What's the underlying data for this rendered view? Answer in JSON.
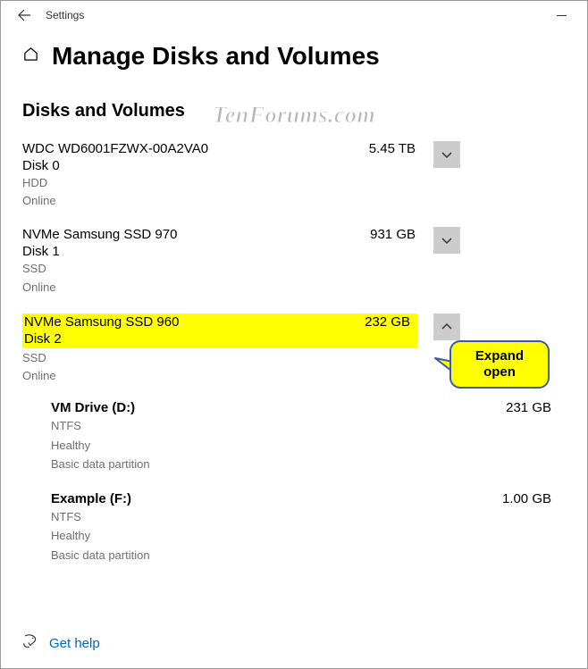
{
  "window": {
    "title": "Settings"
  },
  "page": {
    "title": "Manage Disks and Volumes",
    "section": "Disks and Volumes"
  },
  "disks": [
    {
      "name": "WDC WD6001FZWX-00A2VA0",
      "size": "5.45 TB",
      "label": "Disk 0",
      "type": "HDD",
      "status": "Online",
      "expanded": false
    },
    {
      "name": "NVMe Samsung SSD 970",
      "size": "931 GB",
      "label": "Disk 1",
      "type": "SSD",
      "status": "Online",
      "expanded": false
    },
    {
      "name": "NVMe Samsung SSD 960",
      "size": "232 GB",
      "label": "Disk 2",
      "type": "SSD",
      "status": "Online",
      "expanded": true,
      "volumes": [
        {
          "name": "VM Drive (D:)",
          "size": "231 GB",
          "fs": "NTFS",
          "health": "Healthy",
          "ptype": "Basic data partition"
        },
        {
          "name": "Example (F:)",
          "size": "1.00 GB",
          "fs": "NTFS",
          "health": "Healthy",
          "ptype": "Basic data partition"
        }
      ]
    }
  ],
  "footer": {
    "help": "Get help"
  },
  "callout": {
    "text": "Expand open"
  },
  "watermark": "TenForums.com"
}
